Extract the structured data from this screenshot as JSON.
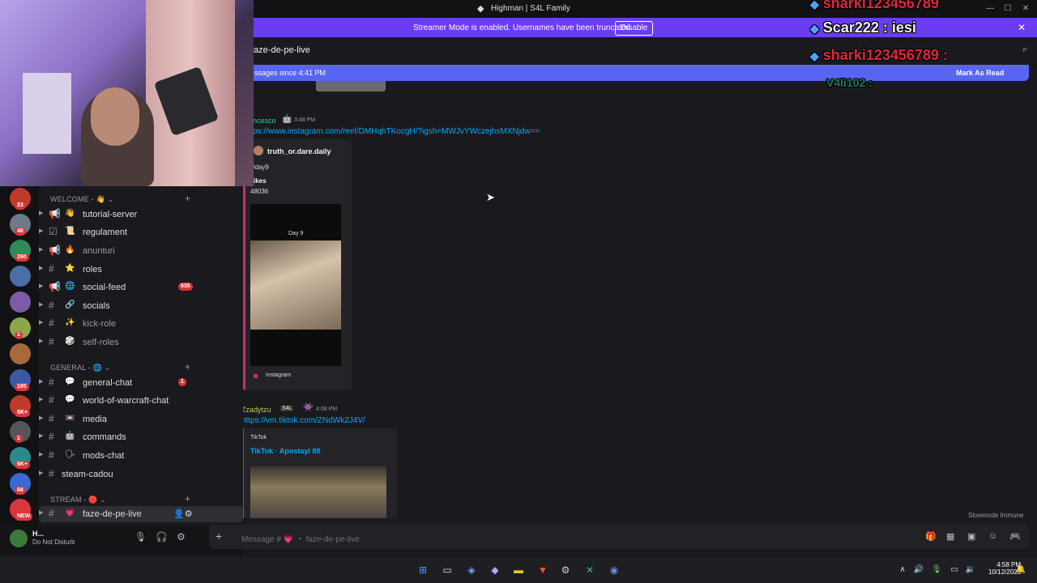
{
  "window": {
    "title": "Highman | S4L Family"
  },
  "streamer_banner": {
    "message": "Streamer Mode is enabled. Usernames have been truncated.",
    "disable_label": "Disable"
  },
  "channel_header": {
    "name": "faze-de-pe-live",
    "search_placeholder": "Search"
  },
  "new_messages_bar": {
    "text": "ssages since 4:41 PM",
    "mark_read": "Mark As Read"
  },
  "overlay_chat": [
    {
      "user": "sharki123456789",
      "text": ""
    },
    {
      "user": "Scar222",
      "text": "iesi"
    },
    {
      "user": "sharki123456789",
      "text": ""
    },
    {
      "user": "V4li102",
      "text": ""
    }
  ],
  "servers": [
    {
      "badge": "23",
      "color": "#c0392b"
    },
    {
      "badge": "48",
      "color": "#6c7a89"
    },
    {
      "badge": "260",
      "color": "#2e8b57"
    },
    {
      "badge": "",
      "color": "#4a6fa5"
    },
    {
      "badge": "",
      "color": "#7d5ba6"
    },
    {
      "badge": "1",
      "color": "#8aa84a"
    },
    {
      "badge": "",
      "color": "#a86a3a"
    },
    {
      "badge": "195",
      "color": "#3a5aa8"
    },
    {
      "badge": "6K+",
      "color": "#c0392b"
    },
    {
      "badge": "1",
      "color": "#555"
    },
    {
      "badge": "6K+",
      "color": "#2a8a8a"
    },
    {
      "badge": "68",
      "color": "#3a6ad0"
    },
    {
      "badge": "NEW",
      "color": "#da373c"
    }
  ],
  "categories": [
    {
      "name": "WELCOME - 👋 ⌄"
    },
    {
      "name": "GENERAL - 🌐 ⌄"
    },
    {
      "name": "STREAM - 🔴 ⌄"
    }
  ],
  "channels": [
    {
      "label": "tutorial-server",
      "emoji": "👋",
      "icon": "📢",
      "badge": "",
      "muted": false
    },
    {
      "label": "regulament",
      "emoji": "📜",
      "icon": "☑",
      "badge": "",
      "muted": false
    },
    {
      "label": "anunturi",
      "emoji": "🔥",
      "icon": "📢",
      "badge": "",
      "muted": true
    },
    {
      "label": "roles",
      "emoji": "⭐",
      "icon": "#",
      "badge": "",
      "muted": false
    },
    {
      "label": "social-feed",
      "emoji": "🌐",
      "icon": "📢",
      "badge": "635",
      "muted": false
    },
    {
      "label": "socials",
      "emoji": "🔗",
      "icon": "#",
      "badge": "",
      "muted": false
    },
    {
      "label": "kick-role",
      "emoji": "✨",
      "icon": "#",
      "badge": "",
      "muted": true
    },
    {
      "label": "self-roles",
      "emoji": "🎲",
      "icon": "#",
      "badge": "",
      "muted": true
    },
    {
      "label": "general-chat",
      "emoji": "💬",
      "icon": "#",
      "badge": "1",
      "muted": false
    },
    {
      "label": "world-of-warcraft-chat",
      "emoji": "💬",
      "icon": "#",
      "badge": "",
      "muted": false
    },
    {
      "label": "media",
      "emoji": "📼",
      "icon": "#",
      "badge": "",
      "muted": false
    },
    {
      "label": "commands",
      "emoji": "🤖",
      "icon": "#",
      "badge": "",
      "muted": false
    },
    {
      "label": "mods-chat",
      "emoji": "🗣",
      "icon": "#",
      "badge": "",
      "muted": false
    },
    {
      "label": "steam-cadou",
      "emoji": "",
      "icon": "#",
      "badge": "",
      "muted": false
    },
    {
      "label": "faze-de-pe-live",
      "emoji": "💗",
      "icon": "#",
      "badge": "",
      "muted": false
    }
  ],
  "user_panel": {
    "name": "H...",
    "status": "Do Not Disturb"
  },
  "messages": [
    {
      "author": "ncesco",
      "time": "3:48 PM",
      "link": "ps://www.instagram.com/reel/DMHqhTKocgH/?igsh=MWJvYWczejhsMXNjdw==",
      "embed": {
        "account": "truth_or.dare.daily",
        "caption": "#day9",
        "likes_label": "ikes",
        "likes": "48036",
        "video_text": "Day 9",
        "provider": "Instagram"
      }
    },
    {
      "author": "Zzadytzu",
      "tag": "S4L",
      "time": "4:08 PM",
      "link": "https://vm.tiktok.com/ZNdWk2J4V/",
      "embed": {
        "provider": "TikTok",
        "title": "TikTok · Apostayl 88"
      }
    }
  ],
  "composer": {
    "placeholder": "Message # 💗 ・ faze-de-pe-live"
  },
  "slowmode": "Slowmode Immune",
  "taskbar": {
    "time": "4:58 PM",
    "date": "10/12/2025"
  }
}
